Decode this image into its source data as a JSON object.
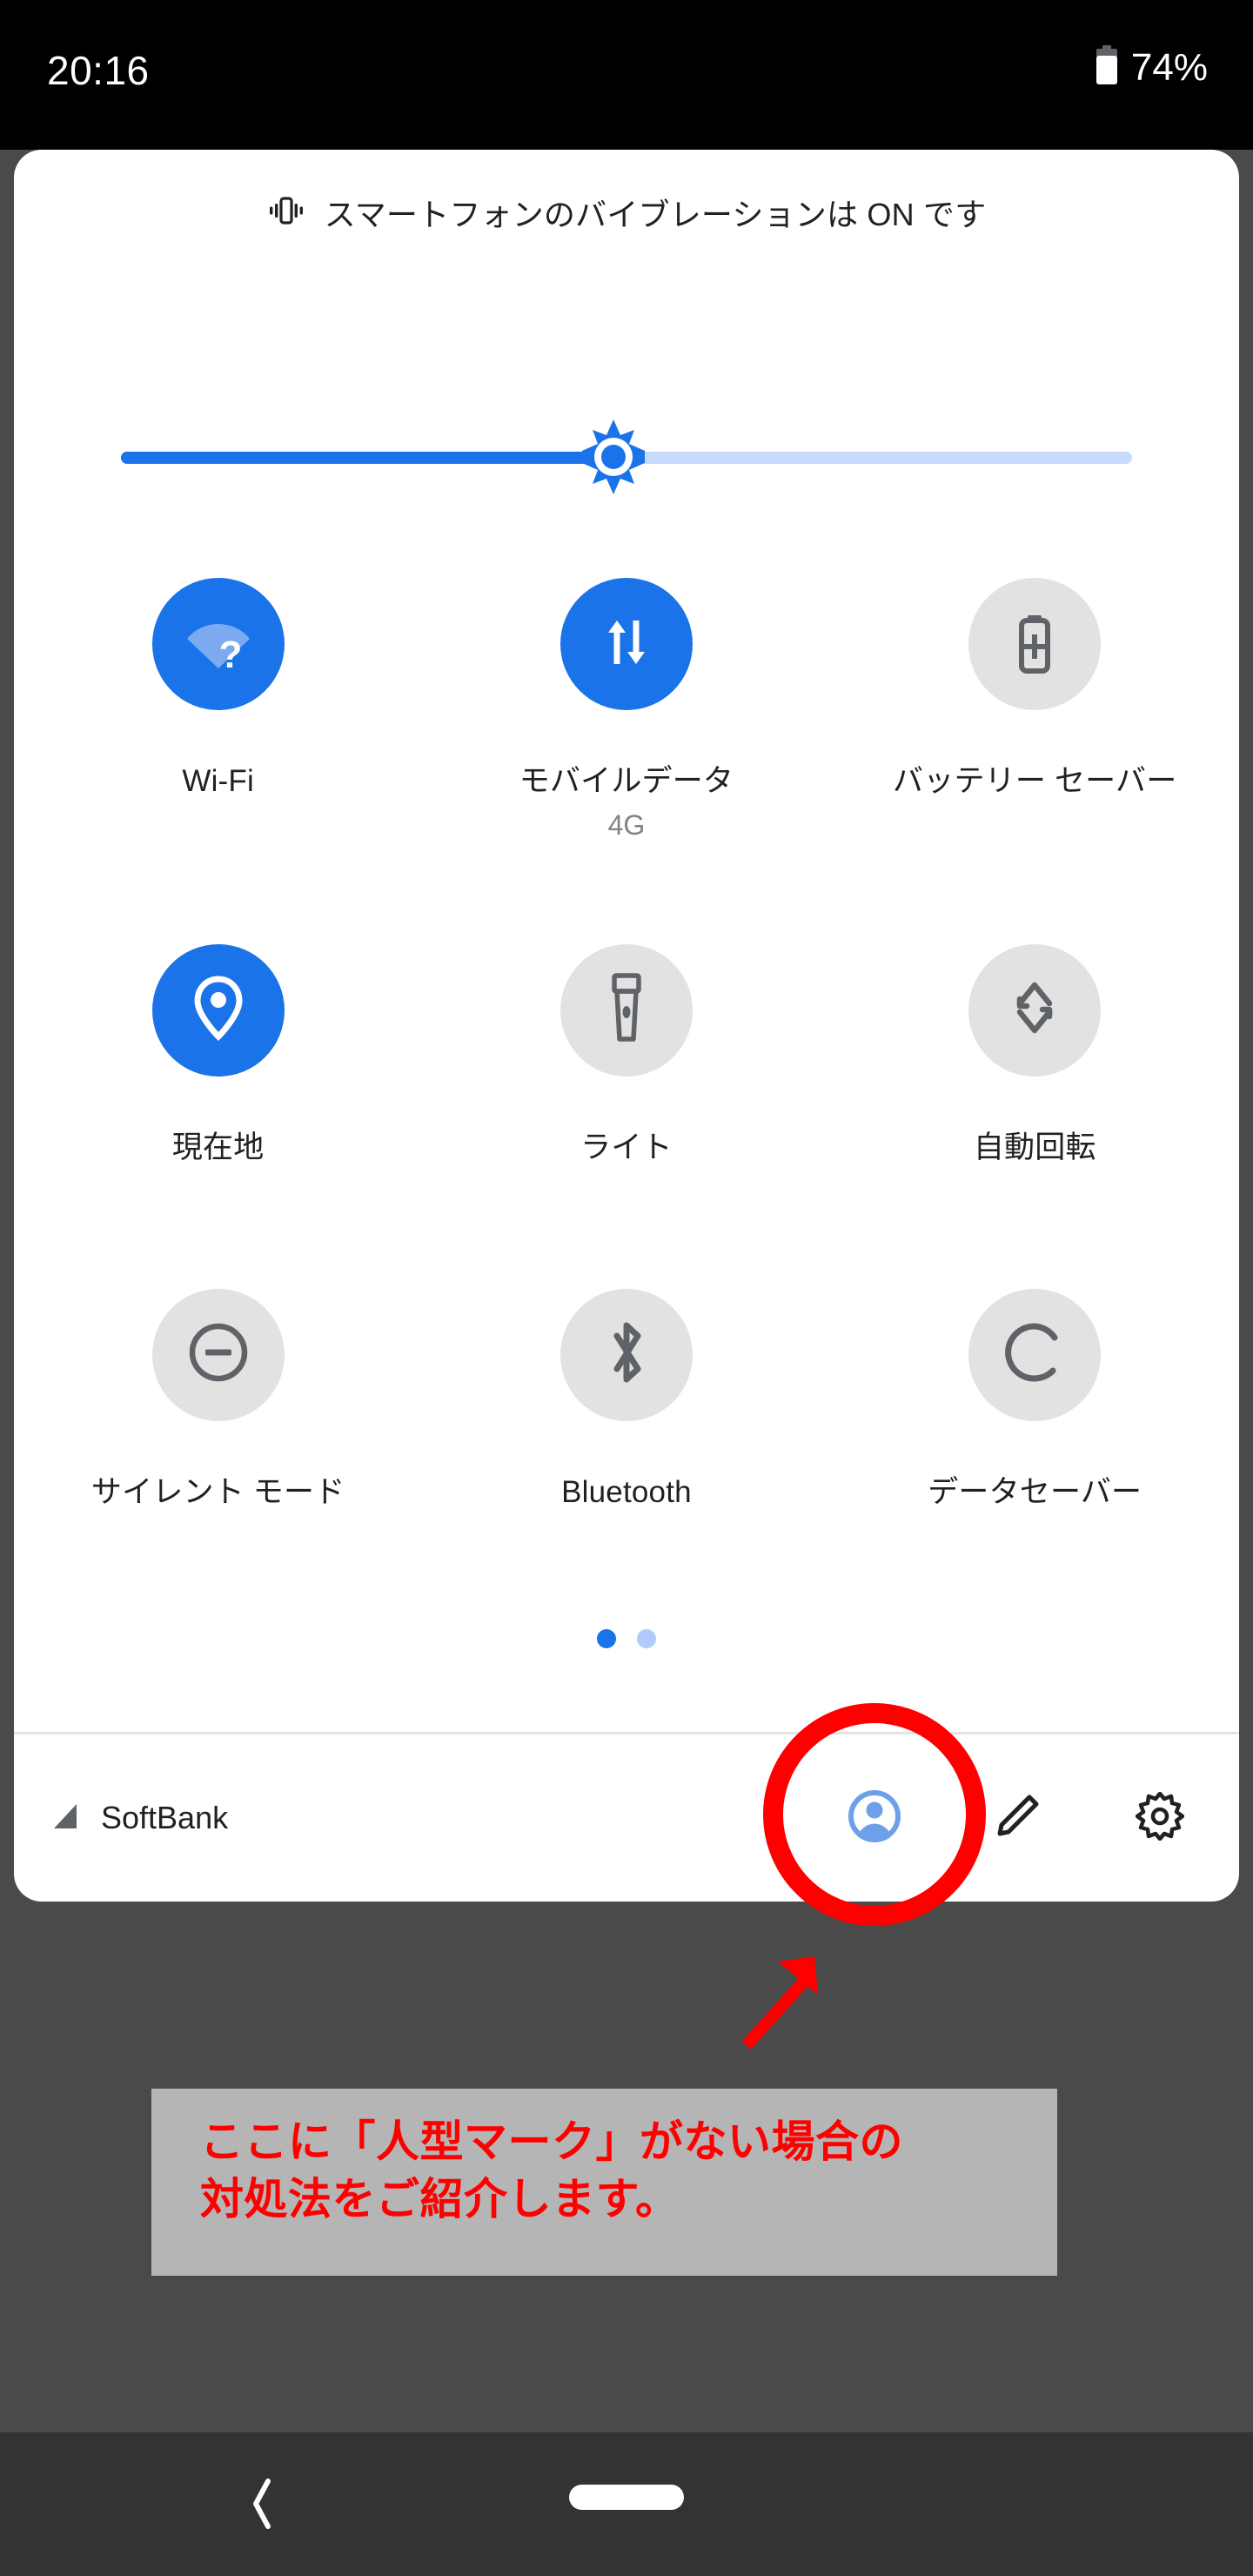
{
  "status_bar": {
    "clock": "20:16",
    "battery_percent": "74%",
    "battery_icon": "battery-icon"
  },
  "quick_settings": {
    "vibration_notice": {
      "icon": "vibration-icon",
      "text": "スマートフォンのバイブレーションは ON です"
    },
    "brightness": {
      "name": "brightness-slider",
      "value_percent": 48,
      "thumb_icon": "brightness-sun-icon",
      "fill_color": "#1a73e8",
      "track_color": "#c6dafc"
    },
    "tiles": [
      {
        "label": "Wi-Fi",
        "sub": "",
        "icon": "wifi-question-icon",
        "state": "on"
      },
      {
        "label": "モバイルデータ",
        "sub": "4G",
        "icon": "mobile-data-icon",
        "state": "on"
      },
      {
        "label": "バッテリー セーバー",
        "sub": "",
        "icon": "battery-saver-icon",
        "state": "off"
      },
      {
        "label": "現在地",
        "sub": "",
        "icon": "location-pin-icon",
        "state": "on"
      },
      {
        "label": "ライト",
        "sub": "",
        "icon": "flashlight-icon",
        "state": "off"
      },
      {
        "label": "自動回転",
        "sub": "",
        "icon": "auto-rotate-icon",
        "state": "off"
      },
      {
        "label": "サイレント モード",
        "sub": "",
        "icon": "do-not-disturb-icon",
        "state": "off"
      },
      {
        "label": "Bluetooth",
        "sub": "",
        "icon": "bluetooth-icon",
        "state": "off"
      },
      {
        "label": "データセーバー",
        "sub": "",
        "icon": "data-saver-icon",
        "state": "off"
      }
    ],
    "pages": {
      "count": 2,
      "active_index": 0
    },
    "footer": {
      "signal_icon": "signal-strength-icon",
      "carrier": "SoftBank",
      "actions": [
        {
          "name": "user-switch-button",
          "icon": "user-avatar-icon"
        },
        {
          "name": "edit-tiles-button",
          "icon": "pencil-icon"
        },
        {
          "name": "settings-button",
          "icon": "gear-icon"
        }
      ]
    }
  },
  "annotations": {
    "highlight_color": "#ff0000",
    "callout_line1": "ここに「人型マーク」がない場合の",
    "callout_line2": "対処法をご紹介します。"
  },
  "nav_bar": {
    "back": "back-chevron-icon",
    "home": "home-pill-icon"
  }
}
